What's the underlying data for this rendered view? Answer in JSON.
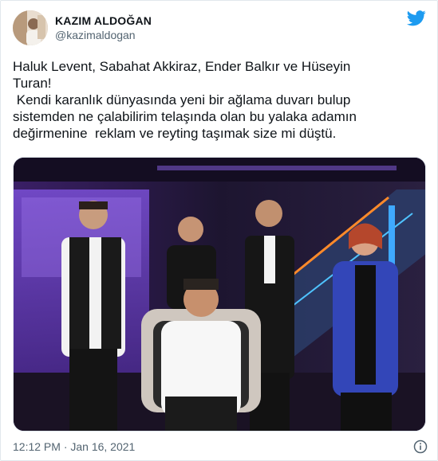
{
  "author": {
    "display_name": "KAZIM ALDOĞAN",
    "handle": "@kazimaldogan"
  },
  "tweet": {
    "text": "Haluk Levent, Sabahat Akkiraz, Ender Balkır ve Hüseyin\nTuran!\n Kendi karanlık dünyasında yeni bir ağlama duvarı bulup\nsistemden ne çalabilirim telaşında olan bu yalaka adamın\ndeğirmenine  reklam ve reyting taşımak size mi düştü.",
    "timestamp": "12:12 PM · Jan 16, 2021"
  },
  "icons": {
    "brand": "twitter-bird-icon",
    "info": "info-icon"
  },
  "colors": {
    "brand_blue": "#1d9bf0",
    "text_primary": "#0f1419",
    "text_secondary": "#536471",
    "border": "#e1e8ed"
  }
}
